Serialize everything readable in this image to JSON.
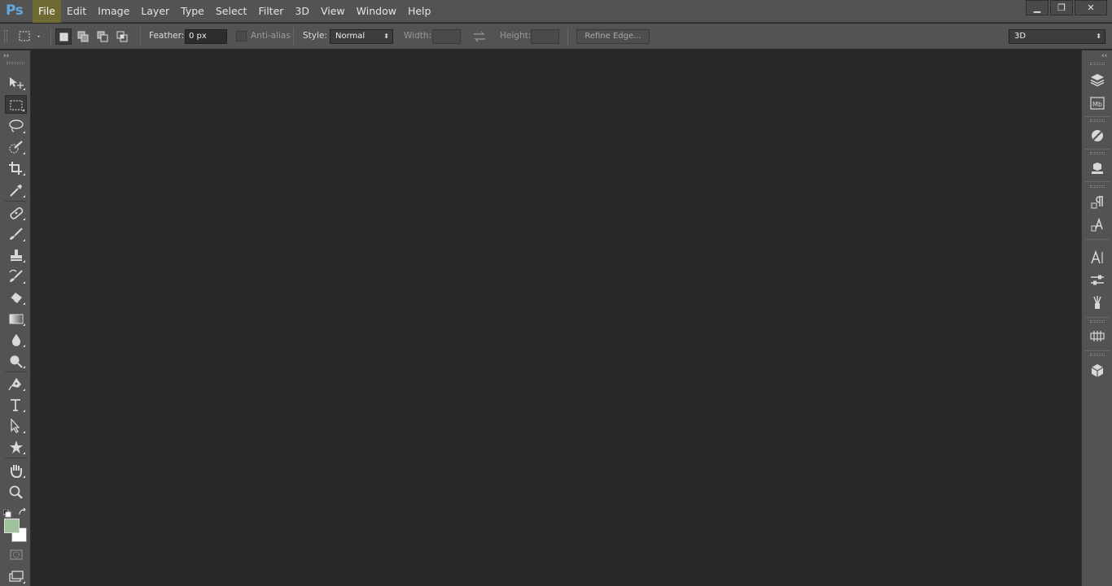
{
  "app": {
    "logo": "Ps",
    "menu": [
      "File",
      "Edit",
      "Image",
      "Layer",
      "Type",
      "Select",
      "Filter",
      "3D",
      "View",
      "Window",
      "Help"
    ],
    "active_menu": "File",
    "window_controls": {
      "minimize": "▁",
      "restore": "❐",
      "close": "✕"
    }
  },
  "options": {
    "feather_label": "Feather:",
    "feather_value": "0 px",
    "antialias_label": "Anti-alias",
    "style_label": "Style:",
    "style_value": "Normal",
    "width_label": "Width:",
    "width_value": "",
    "height_label": "Height:",
    "height_value": "",
    "refine_edge_label": "Refine Edge...",
    "workspace_value": "3D"
  },
  "colors": {
    "foreground": "#9fc39a",
    "background": "#ffffff",
    "active_menu_bg": "#6f6a32",
    "logo": "#62a8df"
  },
  "tools": [
    "move-tool",
    "rectangular-marquee-tool",
    "lasso-tool",
    "quick-selection-tool",
    "crop-tool",
    "eyedropper-tool",
    "spot-healing-brush-tool",
    "brush-tool",
    "clone-stamp-tool",
    "history-brush-tool",
    "eraser-tool",
    "gradient-tool",
    "blur-tool",
    "dodge-tool",
    "pen-tool",
    "type-tool",
    "path-selection-tool",
    "custom-shape-tool",
    "hand-tool",
    "zoom-tool"
  ],
  "dock_panels": [
    "layers",
    "mini-bridge",
    "color",
    "3d-panel",
    "paragraph-styles",
    "character-styles",
    "character",
    "properties",
    "brush-presets",
    "timeline",
    "3d-materials"
  ]
}
